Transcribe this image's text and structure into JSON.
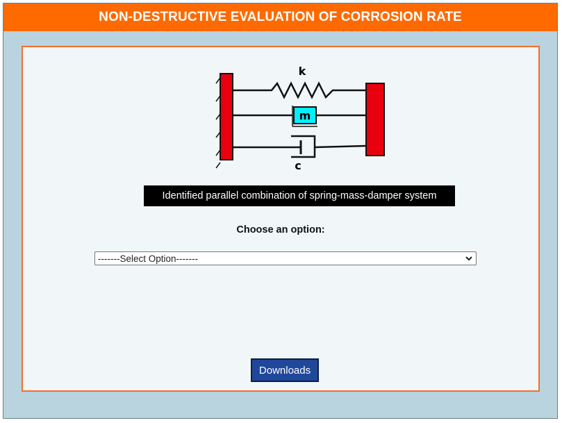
{
  "header": {
    "title": "NON-DESTRUCTIVE EVALUATION OF CORROSION RATE"
  },
  "diagram": {
    "spring_label": "k",
    "mass_label": "m",
    "damper_label": "c",
    "colors": {
      "wall": "#e8000e",
      "mass": "#00f0ff",
      "line": "#111111"
    }
  },
  "caption": "Identified parallel combination of spring-mass-damper system",
  "prompt": "Choose an option:",
  "select": {
    "selected": "-------Select Option-------"
  },
  "downloads_button": "Downloads",
  "colors": {
    "header": "#ff6a00",
    "background": "#b9d3df",
    "panel_border": "#f07030",
    "button": "#20489a"
  }
}
